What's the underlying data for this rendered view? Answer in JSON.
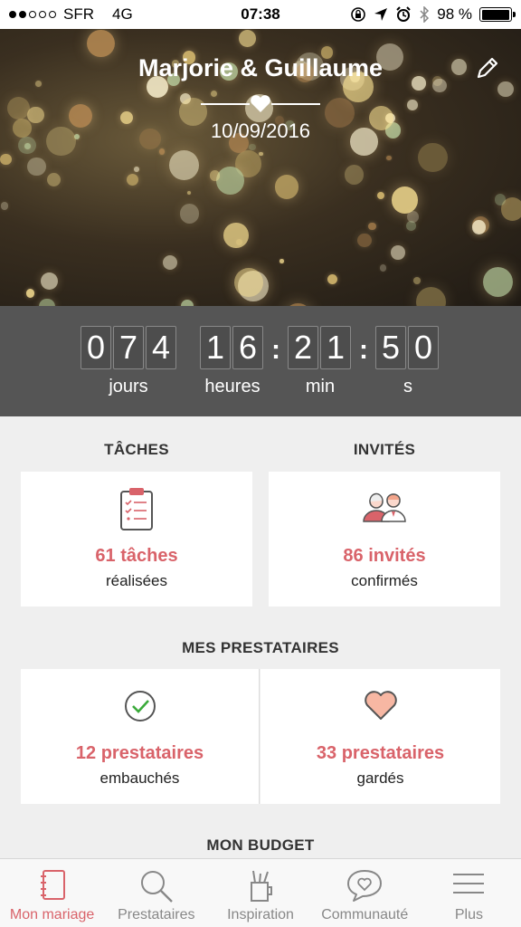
{
  "status_bar": {
    "carrier": "SFR",
    "network": "4G",
    "time": "07:38",
    "battery": "98 %",
    "battery_level": 0.98
  },
  "hero": {
    "couple": "Marjorie & Guillaume",
    "date": "10/09/2016"
  },
  "countdown": {
    "days": [
      "0",
      "7",
      "4"
    ],
    "hours": [
      "1",
      "6"
    ],
    "minutes": [
      "2",
      "1"
    ],
    "seconds": [
      "5",
      "0"
    ],
    "labels": {
      "days": "jours",
      "hours": "heures",
      "minutes": "min",
      "seconds": "s"
    }
  },
  "tasks": {
    "title": "TÂCHES",
    "count": "61 tâches",
    "sub": "réalisées"
  },
  "guests": {
    "title": "INVITÉS",
    "count": "86 invités",
    "sub": "confirmés"
  },
  "vendors": {
    "title": "MES PRESTATAIRES",
    "hired": {
      "count": "12 prestataires",
      "sub": "embauchés"
    },
    "saved": {
      "count": "33 prestataires",
      "sub": "gardés"
    }
  },
  "budget": {
    "title": "MON BUDGET"
  },
  "tabs": [
    {
      "label": "Mon mariage",
      "icon": "notebook-icon",
      "active": true
    },
    {
      "label": "Prestataires",
      "icon": "search-icon",
      "active": false
    },
    {
      "label": "Inspiration",
      "icon": "cup-icon",
      "active": false
    },
    {
      "label": "Communauté",
      "icon": "chat-heart-icon",
      "active": false
    },
    {
      "label": "Plus",
      "icon": "menu-icon",
      "active": false
    }
  ],
  "colors": {
    "accent": "#d9636a",
    "countdown_bg": "#555555",
    "page_bg": "#efefef"
  }
}
